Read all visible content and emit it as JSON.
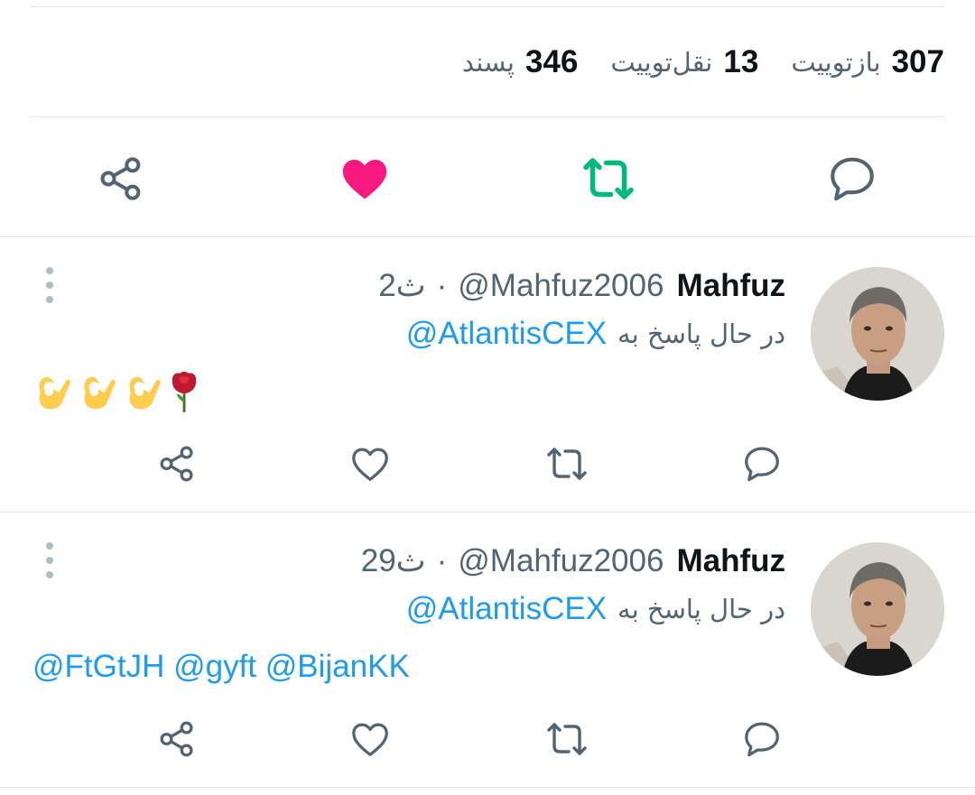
{
  "stats": {
    "retweets": {
      "count": "307",
      "label": "بازتوییت"
    },
    "quotes": {
      "count": "13",
      "label": "نقل‌توییت"
    },
    "likes": {
      "count": "346",
      "label": "پسند"
    }
  },
  "main_actions": {
    "reply_icon": "comment-icon",
    "retweet_icon": "retweet-icon",
    "like_icon": "heart-filled-icon",
    "share_icon": "share-icon",
    "retweet_color": "#00ba7c",
    "like_color": "#f91880"
  },
  "replies": [
    {
      "name": "Mahfuz",
      "handle": "@Mahfuz2006",
      "dot": "·",
      "time": "2ث",
      "replying_prefix": "در حال پاسخ به",
      "replying_to": "@AtlantisCEX",
      "body_emoji": [
        "rose-emoji",
        "ok-hand-emoji",
        "ok-hand-emoji",
        "ok-hand-emoji"
      ]
    },
    {
      "name": "Mahfuz",
      "handle": "@Mahfuz2006",
      "dot": "·",
      "time": "29ث",
      "replying_prefix": "در حال پاسخ به",
      "replying_to": "@AtlantisCEX",
      "body_text": "@FtGtJH @gyft @BijanKK"
    }
  ],
  "colors": {
    "accent": "#1d9bf0",
    "secondary_text": "#536471",
    "icon_gray": "#536471",
    "divider": "#e1e8ed"
  }
}
